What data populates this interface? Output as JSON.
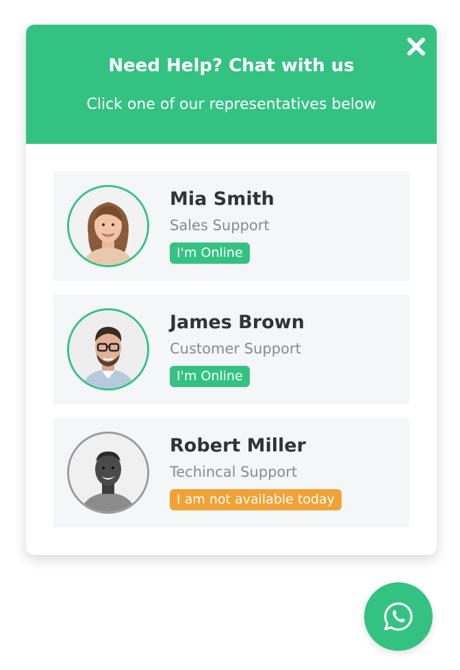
{
  "header": {
    "title": "Need Help? Chat with us",
    "subtitle": "Click one of our representatives below",
    "close_icon": "close-icon"
  },
  "agents": [
    {
      "name": "Mia Smith",
      "role": "Sales Support",
      "status": "I'm Online",
      "status_color": "#34c283",
      "online": true
    },
    {
      "name": "James Brown",
      "role": "Customer Support",
      "status": "I'm Online",
      "status_color": "#34c283",
      "online": true
    },
    {
      "name": "Robert Miller",
      "role": "Techincal Support",
      "status": "I am not available today",
      "status_color": "#f0a236",
      "online": false
    }
  ],
  "launcher": {
    "icon": "whatsapp-icon"
  },
  "colors": {
    "accent": "#34c283",
    "offline": "#f0a236",
    "card_bg": "#f5f6f8",
    "name_text": "#333333",
    "role_text": "#8a8a8a"
  }
}
